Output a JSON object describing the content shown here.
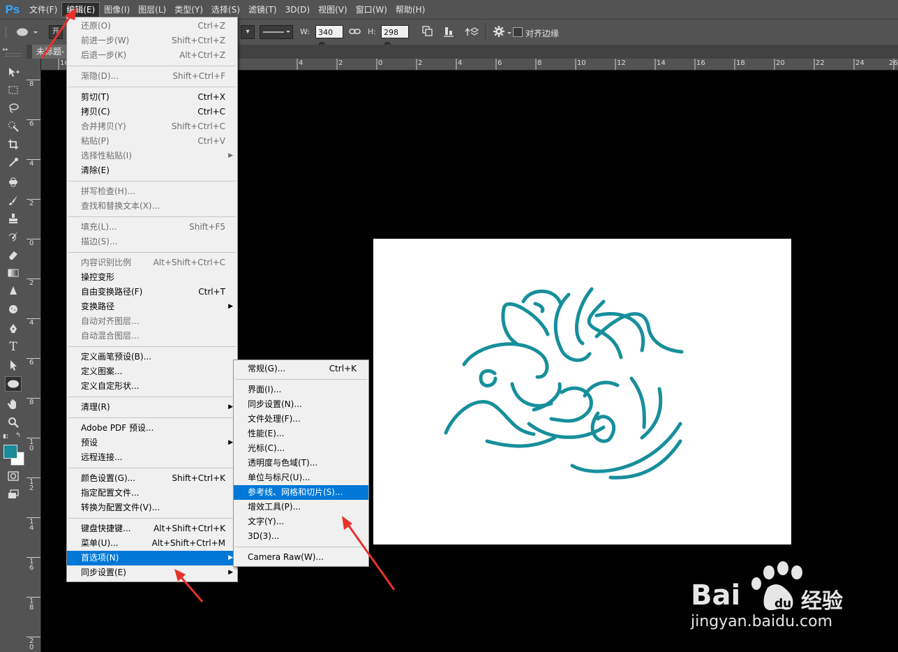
{
  "app": {
    "logo": "Ps"
  },
  "menubar": {
    "items": [
      "文件(F)",
      "编辑(E)",
      "图像(I)",
      "图层(L)",
      "类型(Y)",
      "选择(S)",
      "滤镜(T)",
      "3D(D)",
      "视图(V)",
      "窗口(W)",
      "帮助(H)"
    ],
    "active": "编辑(E)"
  },
  "options": {
    "mode_partial": "开",
    "w_label": "W:",
    "w_value": "340 像",
    "h_label": "H:",
    "h_value": "298 像",
    "align_edges_label": "对齐边缘"
  },
  "document": {
    "tab_title": "未标题-"
  },
  "rulers": {
    "h_ticks": [
      "16",
      "14",
      "4",
      "2",
      "0",
      "2",
      "4",
      "6",
      "8",
      "10",
      "12",
      "14",
      "16",
      "18",
      "20",
      "22",
      "24",
      "26"
    ],
    "v_ticks": [
      "8",
      "6",
      "4",
      "2",
      "0",
      "2",
      "4",
      "6",
      "8",
      "1 0",
      "1 2",
      "1 4",
      "1 6",
      "1 8",
      "2 0"
    ]
  },
  "edit_menu": {
    "groups": [
      [
        {
          "label": "还原(O)",
          "shortcut": "Ctrl+Z",
          "disabled": true
        },
        {
          "label": "前进一步(W)",
          "shortcut": "Shift+Ctrl+Z",
          "disabled": true
        },
        {
          "label": "后退一步(K)",
          "shortcut": "Alt+Ctrl+Z",
          "disabled": true
        }
      ],
      [
        {
          "label": "渐隐(D)...",
          "shortcut": "Shift+Ctrl+F",
          "disabled": true
        }
      ],
      [
        {
          "label": "剪切(T)",
          "shortcut": "Ctrl+X",
          "disabled": false
        },
        {
          "label": "拷贝(C)",
          "shortcut": "Ctrl+C",
          "disabled": false
        },
        {
          "label": "合并拷贝(Y)",
          "shortcut": "Shift+Ctrl+C",
          "disabled": true
        },
        {
          "label": "粘贴(P)",
          "shortcut": "Ctrl+V",
          "disabled": true
        },
        {
          "label": "选择性粘贴(I)",
          "shortcut": "",
          "disabled": true,
          "submenu": true
        },
        {
          "label": "清除(E)",
          "shortcut": "",
          "disabled": false
        }
      ],
      [
        {
          "label": "拼写检查(H)...",
          "shortcut": "",
          "disabled": true
        },
        {
          "label": "查找和替换文本(X)...",
          "shortcut": "",
          "disabled": true
        }
      ],
      [
        {
          "label": "填充(L)...",
          "shortcut": "Shift+F5",
          "disabled": true
        },
        {
          "label": "描边(S)...",
          "shortcut": "",
          "disabled": true
        }
      ],
      [
        {
          "label": "内容识别比例",
          "shortcut": "Alt+Shift+Ctrl+C",
          "disabled": true
        },
        {
          "label": "操控变形",
          "shortcut": "",
          "disabled": false
        },
        {
          "label": "自由变换路径(F)",
          "shortcut": "Ctrl+T",
          "disabled": false
        },
        {
          "label": "变换路径",
          "shortcut": "",
          "disabled": false,
          "submenu": true
        },
        {
          "label": "自动对齐图层...",
          "shortcut": "",
          "disabled": true
        },
        {
          "label": "自动混合图层...",
          "shortcut": "",
          "disabled": true
        }
      ],
      [
        {
          "label": "定义画笔预设(B)...",
          "shortcut": "",
          "disabled": false
        },
        {
          "label": "定义图案...",
          "shortcut": "",
          "disabled": false
        },
        {
          "label": "定义自定形状...",
          "shortcut": "",
          "disabled": false
        }
      ],
      [
        {
          "label": "清理(R)",
          "shortcut": "",
          "disabled": false,
          "submenu": true
        }
      ],
      [
        {
          "label": "Adobe PDF 预设...",
          "shortcut": "",
          "disabled": false
        },
        {
          "label": "预设",
          "shortcut": "",
          "disabled": false,
          "submenu": true
        },
        {
          "label": "远程连接...",
          "shortcut": "",
          "disabled": false
        }
      ],
      [
        {
          "label": "颜色设置(G)...",
          "shortcut": "Shift+Ctrl+K",
          "disabled": false
        },
        {
          "label": "指定配置文件...",
          "shortcut": "",
          "disabled": false
        },
        {
          "label": "转换为配置文件(V)...",
          "shortcut": "",
          "disabled": false
        }
      ],
      [
        {
          "label": "键盘快捷键...",
          "shortcut": "Alt+Shift+Ctrl+K",
          "disabled": false
        },
        {
          "label": "菜单(U)...",
          "shortcut": "Alt+Shift+Ctrl+M",
          "disabled": false
        },
        {
          "label": "首选项(N)",
          "shortcut": "",
          "disabled": false,
          "submenu": true,
          "highlighted": true
        },
        {
          "label": "同步设置(E)",
          "shortcut": "",
          "disabled": false,
          "submenu": true
        }
      ]
    ]
  },
  "prefs_menu": {
    "groups": [
      [
        {
          "label": "常规(G)...",
          "shortcut": "Ctrl+K"
        }
      ],
      [
        {
          "label": "界面(I)...",
          "shortcut": ""
        },
        {
          "label": "同步设置(N)...",
          "shortcut": ""
        },
        {
          "label": "文件处理(F)...",
          "shortcut": ""
        },
        {
          "label": "性能(E)...",
          "shortcut": ""
        },
        {
          "label": "光标(C)...",
          "shortcut": ""
        },
        {
          "label": "透明度与色域(T)...",
          "shortcut": ""
        },
        {
          "label": "单位与标尺(U)...",
          "shortcut": ""
        },
        {
          "label": "参考线、网格和切片(S)...",
          "shortcut": "",
          "highlighted": true
        },
        {
          "label": "增效工具(P)...",
          "shortcut": ""
        },
        {
          "label": "文字(Y)...",
          "shortcut": ""
        },
        {
          "label": "3D(3)...",
          "shortcut": ""
        }
      ],
      [
        {
          "label": "Camera Raw(W)...",
          "shortcut": ""
        }
      ]
    ]
  },
  "watermark": {
    "brand": "Bai",
    "brand_mid": "du",
    "brand_cn": "经验",
    "url": "jingyan.baidu.com"
  },
  "colors": {
    "accent": "#0078d7",
    "swirl": "#178f9b",
    "foreground": "#1a8c98",
    "arrow": "#e8322a"
  }
}
